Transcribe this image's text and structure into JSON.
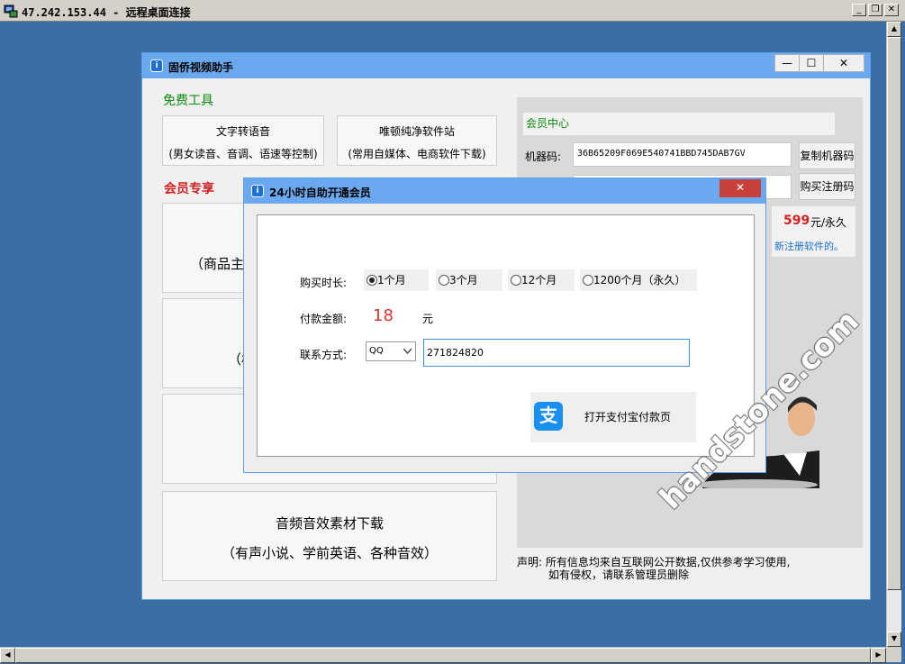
{
  "rdp": {
    "title": "47.242.153.44 - 远程桌面连接",
    "min_icon": "_",
    "restore_icon": "❐",
    "close_icon": "✕"
  },
  "app": {
    "title": "固侨视频助手",
    "logo_glyph": "i",
    "min_icon": "—",
    "max_icon": "☐",
    "close_icon": "✕",
    "free_tools_title": "免费工具",
    "free_tools": [
      {
        "line1": "文字转语音",
        "line2": "(男女读音、音调、语速等控制)"
      },
      {
        "line1": "唯顿纯净软件站",
        "line2": "(常用自媒体、电商软件下载)"
      }
    ],
    "vip_title": "会员专享",
    "vip_cards": [
      {
        "text": "（商品主"
      },
      {
        "text": "（横"
      },
      {
        "text": ""
      },
      {
        "line1": "音频音效素材下载",
        "line2": "（有声小说、学前英语、各种音效）"
      }
    ],
    "member": {
      "center_title": "会员中心",
      "machine_code_label": "机器码:",
      "machine_code": "36B65209F069E540741BBD745DAB7GV",
      "copy_button": "复制机器码",
      "reg_code_value": "",
      "buy_button": "购买注册码",
      "price": "599",
      "price_unit": "元/永久",
      "notice_fragment": "新注册软件的。"
    },
    "disclaimer_line1": "声明: 所有信息均来自互联网公开数据,仅供参考学习使用,",
    "disclaimer_line2": "如有侵权，请联系管理员删除"
  },
  "dialog": {
    "title": "24小时自助开通会员",
    "close_icon": "✕",
    "duration_label": "购买时长:",
    "duration_options": [
      "1个月",
      "3个月",
      "12个月",
      "1200个月（永久）"
    ],
    "duration_selected": 0,
    "amount_label": "付款金额:",
    "amount_value": "18",
    "amount_unit": "元",
    "contact_label": "联系方式:",
    "contact_type": "QQ",
    "contact_value": "271824820",
    "alipay_icon_glyph": "支",
    "alipay_button": "打开支付宝付款页"
  },
  "watermark": "handstone.com",
  "colors": {
    "desktop": "#3a6ea5",
    "titlebar": "#6aa9ef",
    "green_heading": "#0a8a0a",
    "red_heading": "#d02020",
    "price_red": "#d62020",
    "amount_red": "#e03030",
    "alipay_blue": "#1a8ff2",
    "close_red": "#c9403a"
  }
}
